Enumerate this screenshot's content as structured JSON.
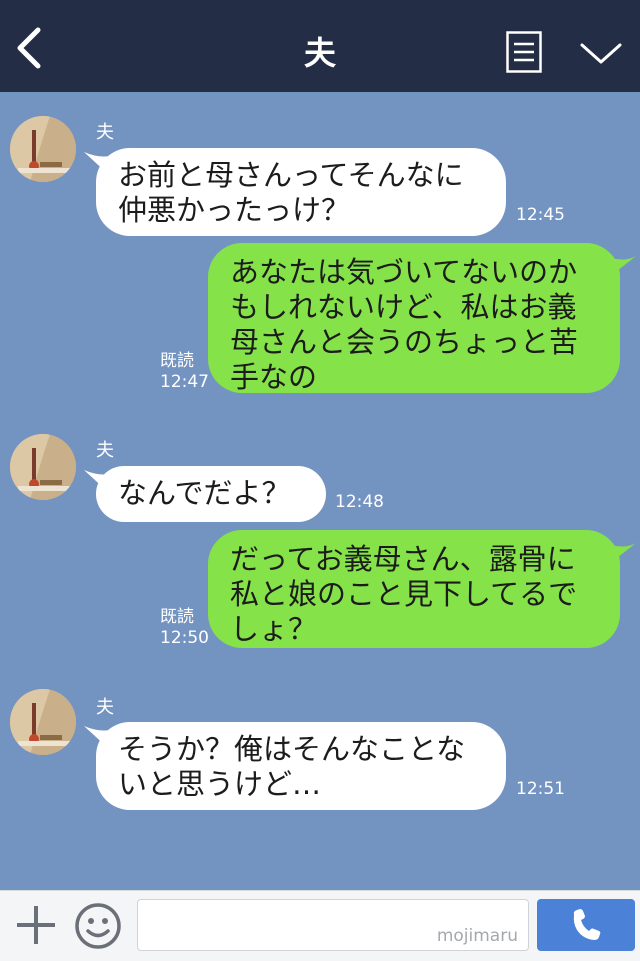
{
  "header": {
    "title": "夫"
  },
  "messages": [
    {
      "sender": "夫",
      "text": "お前と母さんってそんなに\n仲悪かったっけ？",
      "time": "12:45"
    },
    {
      "read": "既読",
      "text": "あなたは気づいてないのか\nもしれないけど、私はお義\n母さんと会うのちょっと苦\n手なの",
      "time": "12:47"
    },
    {
      "sender": "夫",
      "text": "なんでだよ？",
      "time": "12:48"
    },
    {
      "read": "既読",
      "text": "だってお義母さん、露骨に\n私と娘のこと見下してるで\nしょ？",
      "time": "12:50"
    },
    {
      "sender": "夫",
      "text": "そうか？俺はそんなことな\nいと思うけど…",
      "time": "12:51"
    }
  ],
  "input_bar": {
    "watermark": "mojimaru"
  },
  "icons": {
    "back": "chevron-left-icon",
    "menu": "notes-icon",
    "down": "chevron-down-icon",
    "plus": "plus-icon",
    "emoji": "smiley-icon",
    "call": "phone-icon"
  },
  "colors": {
    "background": "#7393c1",
    "header": "#232d45",
    "outgoing": "#85e249",
    "incoming": "#ffffff",
    "call": "#4b82d7"
  }
}
